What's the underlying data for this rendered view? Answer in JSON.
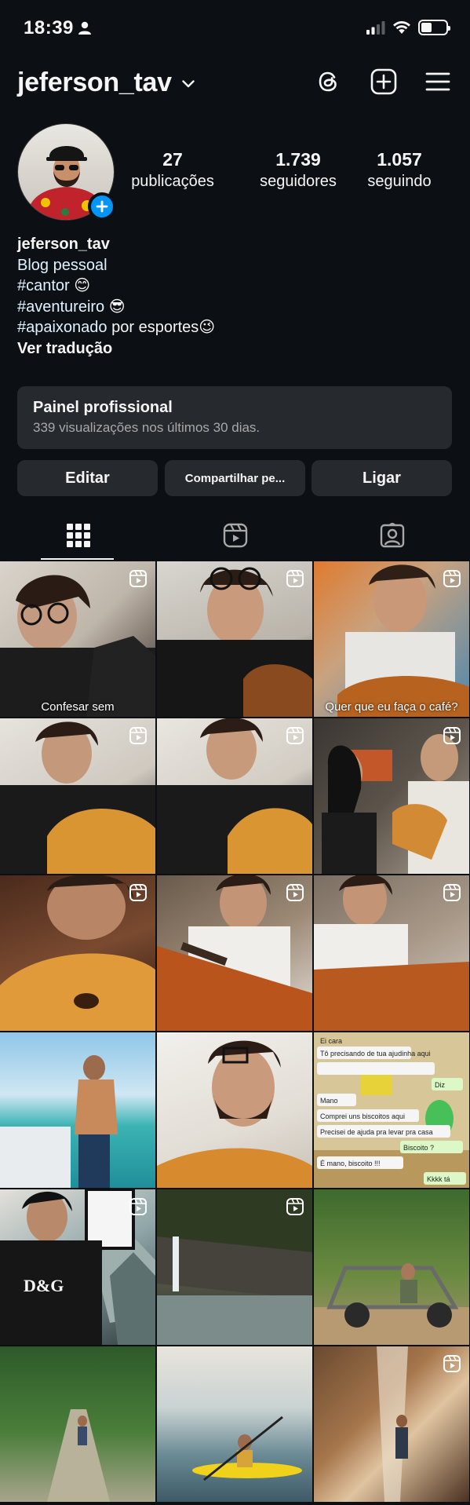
{
  "status_bar": {
    "time": "18:39"
  },
  "header": {
    "username": "jeferson_tav"
  },
  "stats": [
    {
      "value": "27",
      "label": "publicações"
    },
    {
      "value": "1.739",
      "label": "seguidores"
    },
    {
      "value": "1.057",
      "label": "seguindo"
    }
  ],
  "bio": {
    "name": "jeferson_tav",
    "category": "Blog pessoal",
    "line_cantor_tag": "#cantor",
    "line_cantor_emoji": "😊",
    "line_aventureiro_tag": "#aventureiro",
    "line_aventureiro_emoji": "😎",
    "line_apaixonado_tag": "#apaixonado",
    "line_apaixonado_rest": " por esportes",
    "line_apaixonado_emoji": "😉",
    "translate": "Ver tradução"
  },
  "panel": {
    "title": "Painel profissional",
    "subtitle": "339 visualizações nos últimos 30 dias."
  },
  "buttons": {
    "edit": "Editar",
    "share": "Compartilhar pe...",
    "call": "Ligar"
  },
  "grid": {
    "captions": {
      "cell_0": "Confesar sem",
      "cell_2": "Quer que eu faça o café?"
    },
    "chat_bubbles": [
      "Ei cara",
      "Tô precisando de tua ajudinha aqui",
      "Diz",
      "Mano",
      "Comprei uns biscoitos aqui",
      "Precisei de ajuda pra levar pra casa",
      "Biscoito ?",
      "É mano, biscoito !!!",
      "Kkkk tá"
    ],
    "shirt_text": "D&G"
  },
  "icons": {
    "threads": "threads-icon",
    "new_post": "plus-square-icon",
    "menu": "hamburger-menu-icon",
    "grid_tab": "grid-icon",
    "reels_tab": "reels-icon",
    "tagged_tab": "tagged-person-icon",
    "reel_badge": "reels-icon"
  },
  "colors": {
    "background": "#0c1014",
    "surface": "#262a2f",
    "link": "#e0f1ff",
    "accent": "#0095f6"
  }
}
